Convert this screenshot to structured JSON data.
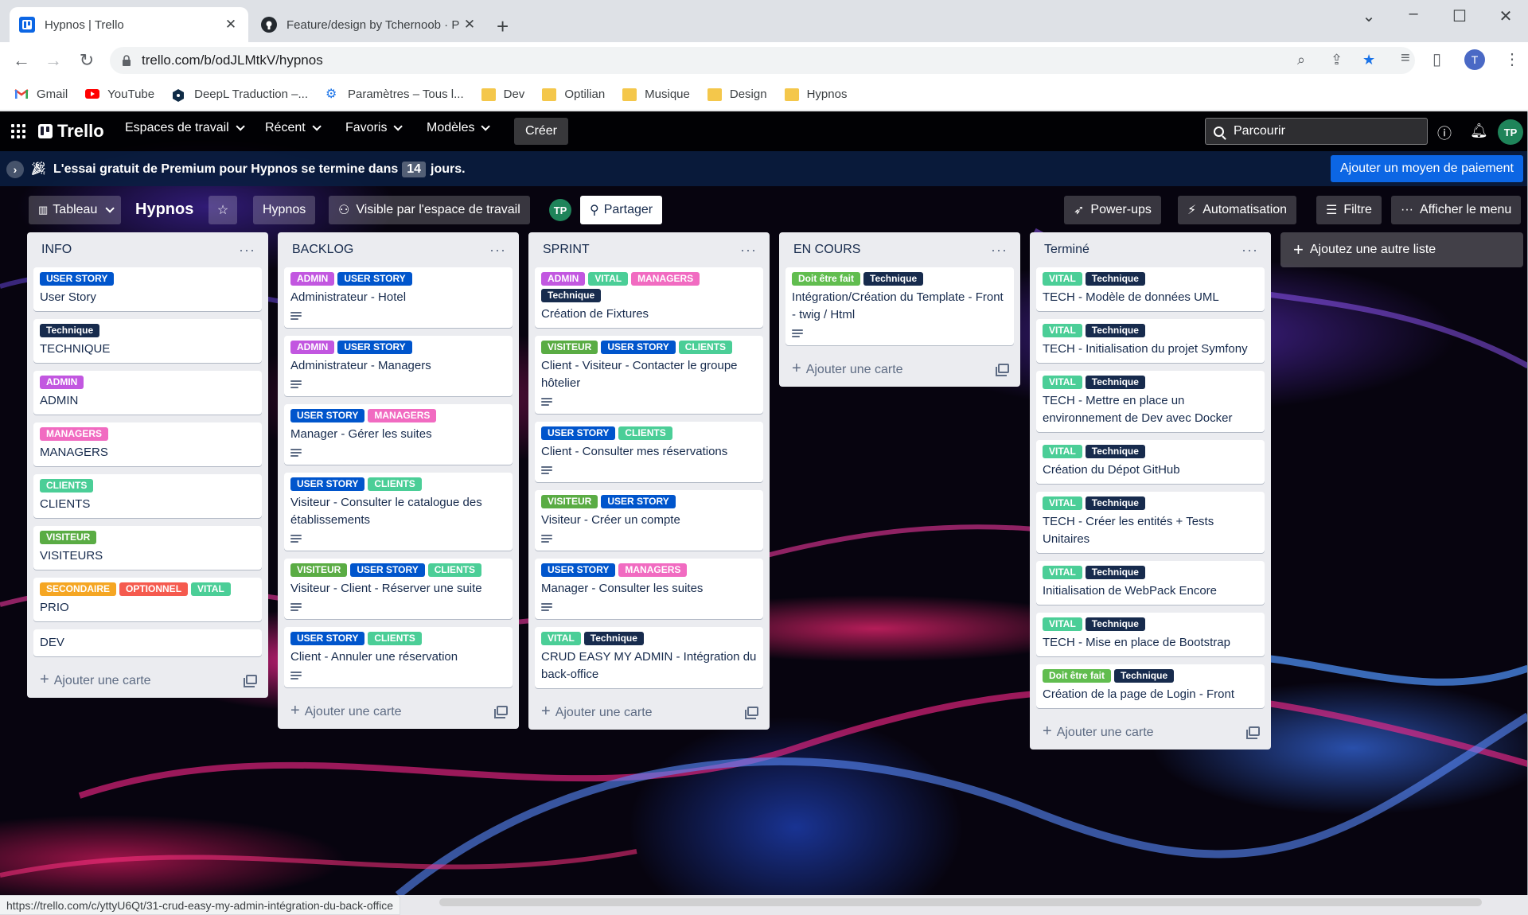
{
  "browser": {
    "tabs": [
      {
        "title": "Hypnos | Trello",
        "active": true,
        "icon": "trello-favicon"
      },
      {
        "title": "Feature/design by Tchernoob · P",
        "active": false,
        "icon": "github-favicon"
      }
    ],
    "url": "trello.com/b/odJLMtkV/hypnos",
    "profile_initial": "T",
    "bookmarks": [
      {
        "label": "Gmail",
        "icon": "gmail-icon"
      },
      {
        "label": "YouTube",
        "icon": "youtube-icon"
      },
      {
        "label": "DeepL Traduction –...",
        "icon": "deepl-icon"
      },
      {
        "label": "Paramètres – Tous l...",
        "icon": "settings-gear-icon"
      },
      {
        "label": "Dev",
        "icon": "folder-icon"
      },
      {
        "label": "Optilian",
        "icon": "folder-icon"
      },
      {
        "label": "Musique",
        "icon": "folder-icon"
      },
      {
        "label": "Design",
        "icon": "folder-icon"
      },
      {
        "label": "Hypnos",
        "icon": "folder-icon"
      }
    ],
    "status_url": "https://trello.com/c/yttyU6Qt/31-crud-easy-my-admin-intégration-du-back-office"
  },
  "topnav": {
    "logo": "Trello",
    "menu": [
      "Espaces de travail",
      "Récent",
      "Favoris",
      "Modèles"
    ],
    "create": "Créer",
    "search_placeholder": "Parcourir",
    "avatar": "TP"
  },
  "banner": {
    "text_before": "L'essai gratuit de Premium pour Hypnos se termine dans",
    "days": "14",
    "text_after": "jours.",
    "button": "Ajouter un moyen de paiement"
  },
  "boardbar": {
    "view": "Tableau",
    "title": "Hypnos",
    "workspace": "Hypnos",
    "visibility": "Visible par l'espace de travail",
    "member": "TP",
    "share": "Partager",
    "powerups": "Power-ups",
    "automation": "Automatisation",
    "filter": "Filtre",
    "menu": "Afficher le menu"
  },
  "label_colors": {
    "USER STORY": "#0055cc",
    "Technique": "#172b4d",
    "ADMIN": "#c257e0",
    "MANAGERS": "#f16bc1",
    "CLIENTS": "#4bce97",
    "VISITEUR": "#5aac44",
    "SECONDAIRE": "#f5a623",
    "OPTIONNEL": "#f55a4e",
    "VITAL": "#4bce97",
    "Doit être fait": "#61bd4f"
  },
  "add_card_label": "Ajouter une carte",
  "add_list_label": "Ajoutez une autre liste",
  "lists": [
    {
      "title": "INFO",
      "cards": [
        {
          "labels": [
            "USER STORY"
          ],
          "title": "User Story",
          "desc": false
        },
        {
          "labels": [
            "Technique"
          ],
          "title": "TECHNIQUE",
          "desc": false
        },
        {
          "labels": [
            "ADMIN"
          ],
          "title": "ADMIN",
          "desc": false
        },
        {
          "labels": [
            "MANAGERS"
          ],
          "title": "MANAGERS",
          "desc": false
        },
        {
          "labels": [
            "CLIENTS"
          ],
          "title": "CLIENTS",
          "desc": false
        },
        {
          "labels": [
            "VISITEUR"
          ],
          "title": "VISITEURS",
          "desc": false
        },
        {
          "labels": [
            "SECONDAIRE",
            "OPTIONNEL",
            "VITAL"
          ],
          "title": "PRIO",
          "desc": false
        },
        {
          "labels": [],
          "title": "DEV",
          "desc": false
        }
      ]
    },
    {
      "title": "BACKLOG",
      "cards": [
        {
          "labels": [
            "ADMIN",
            "USER STORY"
          ],
          "title": "Administrateur - Hotel",
          "desc": true
        },
        {
          "labels": [
            "ADMIN",
            "USER STORY"
          ],
          "title": "Administrateur - Managers",
          "desc": true
        },
        {
          "labels": [
            "USER STORY",
            "MANAGERS"
          ],
          "title": "Manager - Gérer les suites",
          "desc": true
        },
        {
          "labels": [
            "USER STORY",
            "CLIENTS"
          ],
          "title": "Visiteur - Consulter le catalogue des établissements",
          "desc": true
        },
        {
          "labels": [
            "VISITEUR",
            "USER STORY",
            "CLIENTS"
          ],
          "title": "Visiteur - Client - Réserver une suite",
          "desc": true
        },
        {
          "labels": [
            "USER STORY",
            "CLIENTS"
          ],
          "title": "Client - Annuler une réservation",
          "desc": true
        }
      ]
    },
    {
      "title": "SPRINT",
      "cards": [
        {
          "labels": [
            "ADMIN",
            "VITAL",
            "MANAGERS",
            "Technique"
          ],
          "title": "Création de Fixtures",
          "desc": false
        },
        {
          "labels": [
            "VISITEUR",
            "USER STORY",
            "CLIENTS"
          ],
          "title": "Client - Visiteur - Contacter le groupe hôtelier",
          "desc": true
        },
        {
          "labels": [
            "USER STORY",
            "CLIENTS"
          ],
          "title": "Client - Consulter mes réservations",
          "desc": true
        },
        {
          "labels": [
            "VISITEUR",
            "USER STORY"
          ],
          "title": "Visiteur - Créer un compte",
          "desc": true
        },
        {
          "labels": [
            "USER STORY",
            "MANAGERS"
          ],
          "title": "Manager - Consulter les suites",
          "desc": true
        },
        {
          "labels": [
            "VITAL",
            "Technique"
          ],
          "title": "CRUD EASY MY ADMIN - Intégration du back-office",
          "desc": false
        }
      ]
    },
    {
      "title": "EN COURS",
      "cards": [
        {
          "labels": [
            "Doit être fait",
            "Technique"
          ],
          "title": "Intégration/Création du Template - Front - twig / Html",
          "desc": true
        }
      ]
    },
    {
      "title": "Terminé",
      "cards": [
        {
          "labels": [
            "VITAL",
            "Technique"
          ],
          "title": "TECH - Modèle de données UML",
          "desc": false
        },
        {
          "labels": [
            "VITAL",
            "Technique"
          ],
          "title": "TECH - Initialisation du projet Symfony",
          "desc": false
        },
        {
          "labels": [
            "VITAL",
            "Technique"
          ],
          "title": "TECH - Mettre en place un environnement de Dev avec Docker",
          "desc": false
        },
        {
          "labels": [
            "VITAL",
            "Technique"
          ],
          "title": "Création du Dépot GitHub",
          "desc": false
        },
        {
          "labels": [
            "VITAL",
            "Technique"
          ],
          "title": "TECH - Créer les entités + Tests Unitaires",
          "desc": false
        },
        {
          "labels": [
            "VITAL",
            "Technique"
          ],
          "title": "Initialisation de WebPack Encore",
          "desc": false
        },
        {
          "labels": [
            "VITAL",
            "Technique"
          ],
          "title": "TECH - Mise en place de Bootstrap",
          "desc": false
        },
        {
          "labels": [
            "Doit être fait",
            "Technique"
          ],
          "title": "Création de la page de Login - Front",
          "desc": false
        }
      ]
    }
  ]
}
